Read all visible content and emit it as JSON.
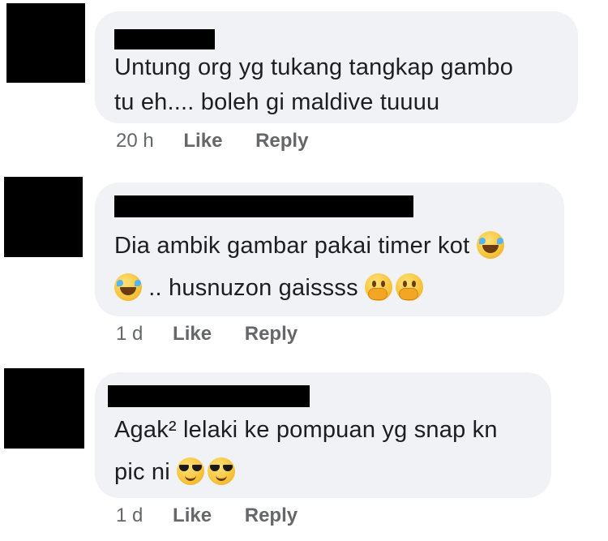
{
  "comments": [
    {
      "lines": [
        "Untung org yg tukang tangkap gambo",
        "tu eh.... boleh gi maldive tuuuu"
      ],
      "time": "20 h",
      "like": "Like",
      "reply": "Reply"
    },
    {
      "lines": [
        "Dia ambik gambar pakai timer kot",
        ".. husnuzon gaissss"
      ],
      "emojis": [
        "rolling-on-floor-laughing",
        "rolling-on-floor-laughing",
        "face-with-hand-over-mouth",
        "face-with-hand-over-mouth"
      ],
      "time": "1 d",
      "like": "Like",
      "reply": "Reply"
    },
    {
      "lines": [
        "Agak² lelaki ke pompuan yg snap kn",
        "pic ni"
      ],
      "emojis": [
        "smiling-face-with-sunglasses",
        "smiling-face-with-sunglasses"
      ],
      "time": "1 d",
      "like": "Like",
      "reply": "Reply"
    }
  ],
  "colors": {
    "bubble": "#f0f2f5",
    "text": "#1c1e21",
    "meta": "#65676b",
    "redaction": "#000000"
  }
}
